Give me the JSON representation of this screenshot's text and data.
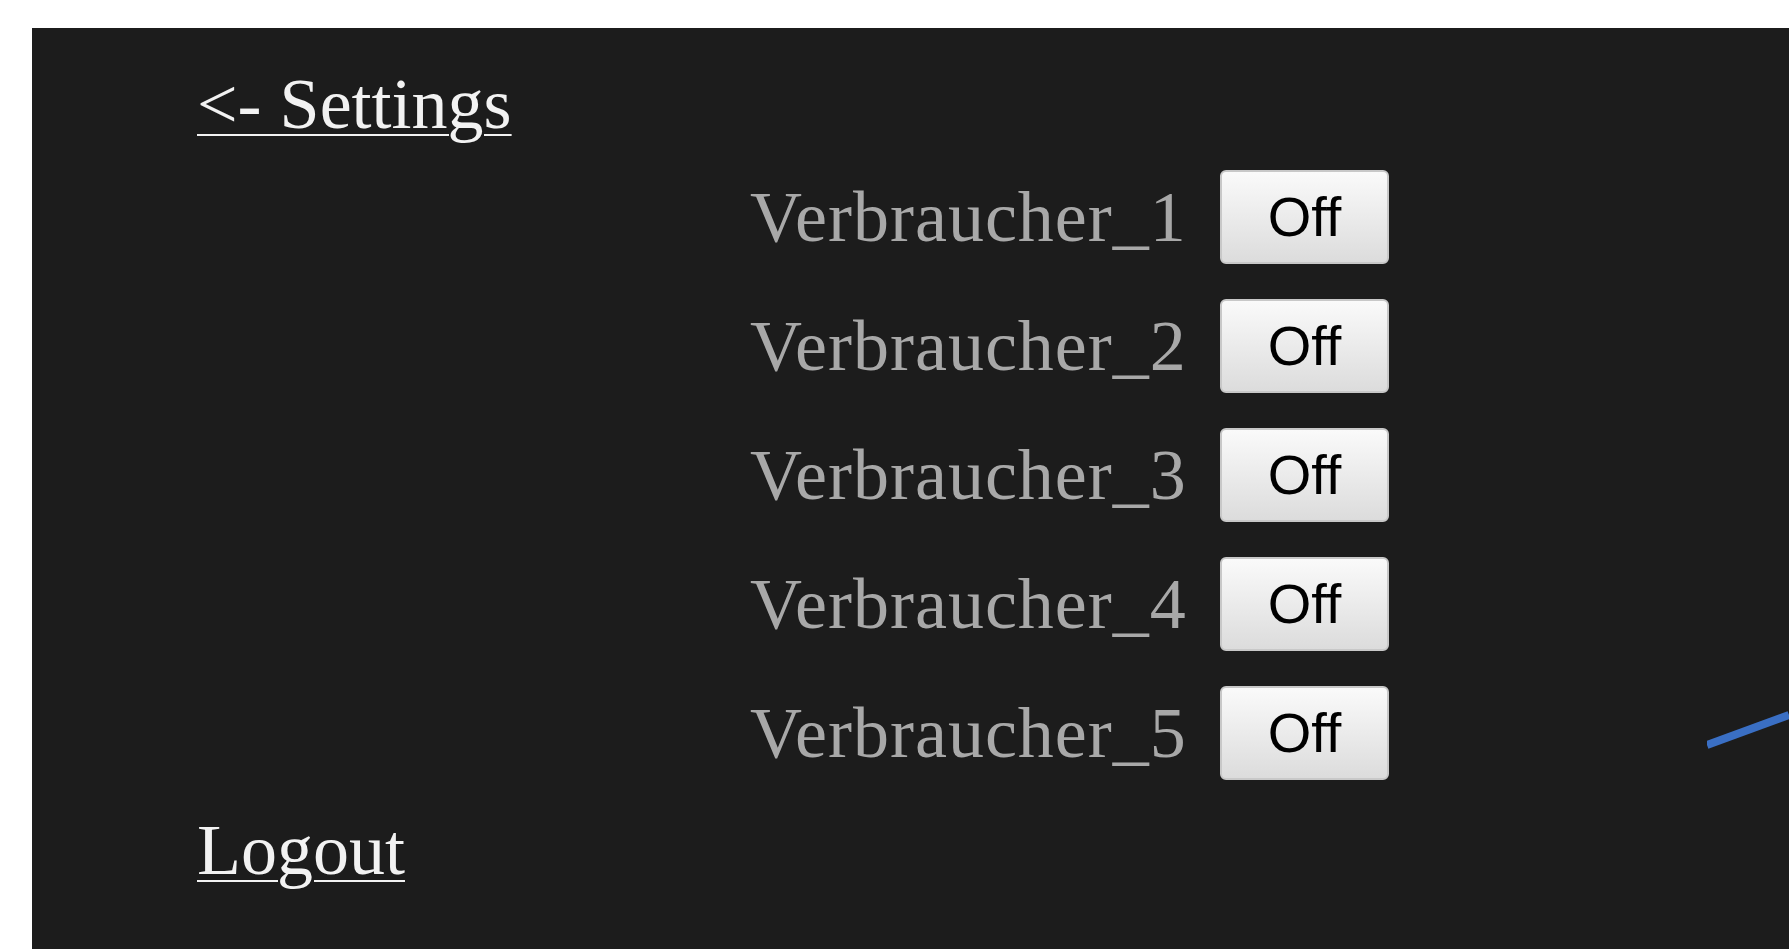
{
  "back_link": "<- Settings",
  "devices": [
    {
      "name": "Verbraucher_1",
      "button": "Off"
    },
    {
      "name": "Verbraucher_2",
      "button": "Off"
    },
    {
      "name": "Verbraucher_3",
      "button": "Off"
    },
    {
      "name": "Verbraucher_4",
      "button": "Off"
    },
    {
      "name": "Verbraucher_5",
      "button": "Off"
    }
  ],
  "logout": "Logout"
}
